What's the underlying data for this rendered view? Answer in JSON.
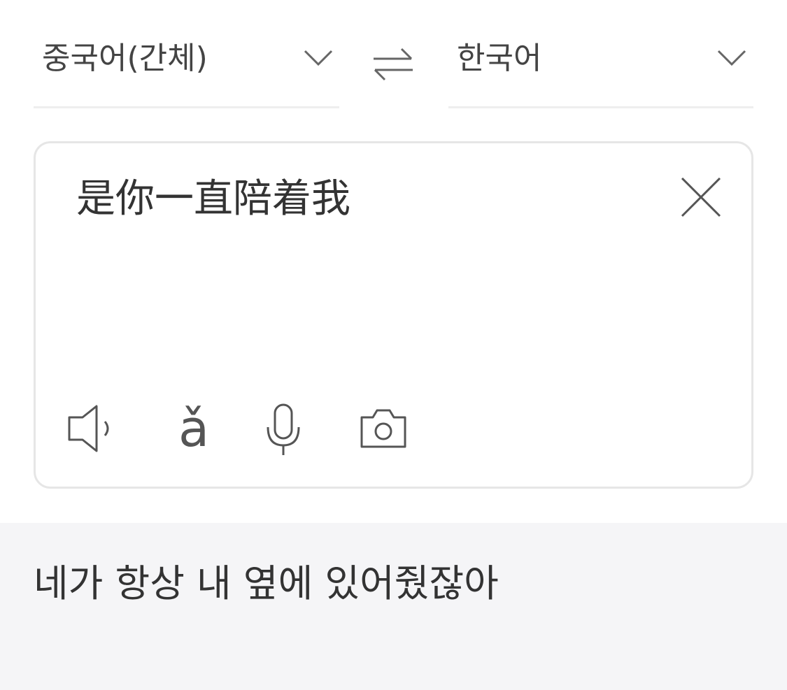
{
  "languages": {
    "source": "중국어(간체)",
    "target": "한국어"
  },
  "input": {
    "text": "是你一直陪着我"
  },
  "tools": {
    "pinyin_glyph": "ǎ",
    "icons": [
      "speaker-icon",
      "pinyin-icon",
      "microphone-icon",
      "camera-icon",
      "close-icon",
      "swap-icon",
      "chevron-down-icon"
    ]
  },
  "result": {
    "text": "네가 항상 내 옆에 있어줬잖아"
  },
  "colors": {
    "result_background": "#f5f5f7",
    "card_border": "#e6e6e6",
    "icon_stroke": "#555555"
  }
}
